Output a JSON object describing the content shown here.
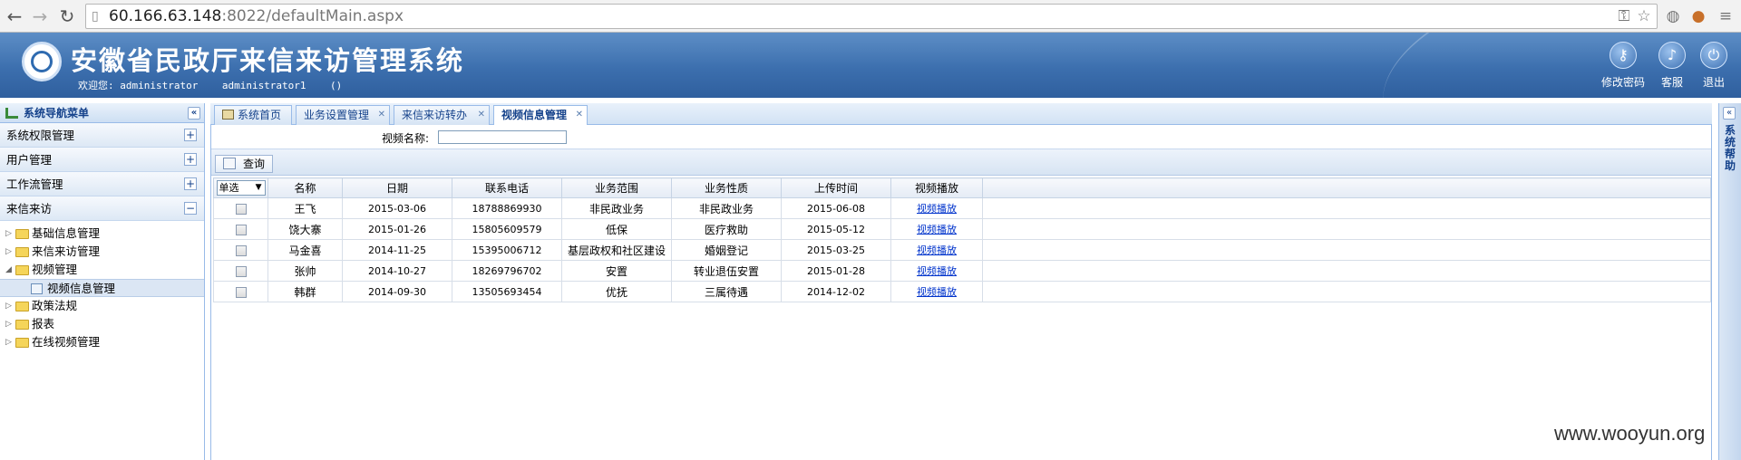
{
  "browser": {
    "url_host": "60.166.63.148",
    "url_rest": ":8022/defaultMain.aspx"
  },
  "header": {
    "title": "安徽省民政厅来信来访管理系统",
    "welcome": "欢迎您: administrator    administrator1    ()",
    "buttons": [
      {
        "label": "修改密码",
        "icon": "key-icon"
      },
      {
        "label": "客服",
        "icon": "bell-icon"
      },
      {
        "label": "退出",
        "icon": "power-icon"
      }
    ]
  },
  "nav": {
    "title": "系统导航菜单",
    "sections": [
      {
        "label": "系统权限管理",
        "toggle": "+"
      },
      {
        "label": "用户管理",
        "toggle": "+"
      },
      {
        "label": "工作流管理",
        "toggle": "+"
      },
      {
        "label": "来信来访",
        "toggle": "−"
      }
    ],
    "tree": [
      {
        "label": "基础信息管理"
      },
      {
        "label": "来信来访管理"
      },
      {
        "label": "视频管理"
      },
      {
        "label": "视频信息管理"
      },
      {
        "label": "政策法规"
      },
      {
        "label": "报表"
      },
      {
        "label": "在线视频管理"
      }
    ]
  },
  "tabs": [
    {
      "label": "系统首页"
    },
    {
      "label": "业务设置管理"
    },
    {
      "label": "来信来访转办"
    },
    {
      "label": "视频信息管理"
    }
  ],
  "search": {
    "label": "视频名称:",
    "value": "",
    "query_label": "查询"
  },
  "grid": {
    "select_label": "单选",
    "columns": [
      "名称",
      "日期",
      "联系电话",
      "业务范围",
      "业务性质",
      "上传时间",
      "视频播放"
    ],
    "rows": [
      {
        "name": "王飞",
        "date": "2015-03-06",
        "phone": "18788869930",
        "scope": "非民政业务",
        "nature": "非民政业务",
        "upload": "2015-06-08",
        "play": "视频播放"
      },
      {
        "name": "饶大寨",
        "date": "2015-01-26",
        "phone": "15805609579",
        "scope": "低保",
        "nature": "医疗救助",
        "upload": "2015-05-12",
        "play": "视频播放"
      },
      {
        "name": "马金喜",
        "date": "2014-11-25",
        "phone": "15395006712",
        "scope": "基层政权和社区建设",
        "nature": "婚姻登记",
        "upload": "2015-03-25",
        "play": "视频播放"
      },
      {
        "name": "张帅",
        "date": "2014-10-27",
        "phone": "18269796702",
        "scope": "安置",
        "nature": "转业退伍安置",
        "upload": "2015-01-28",
        "play": "视频播放"
      },
      {
        "name": "韩群",
        "date": "2014-09-30",
        "phone": "13505693454",
        "scope": "优抚",
        "nature": "三属待遇",
        "upload": "2014-12-02",
        "play": "视频播放"
      }
    ]
  },
  "right_panel": {
    "label": "系统帮助"
  },
  "watermark": "www.wooyun.org"
}
